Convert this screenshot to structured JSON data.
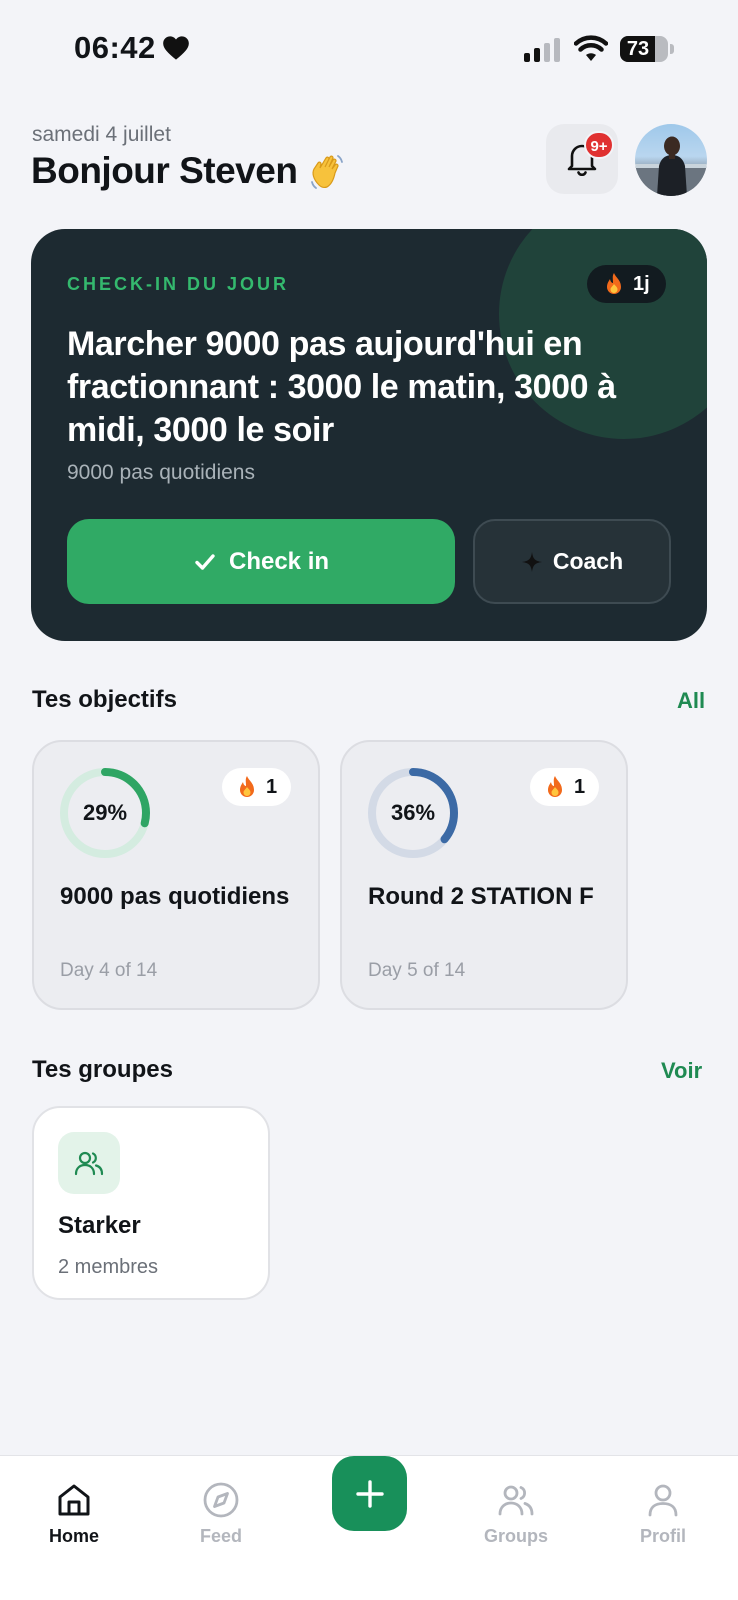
{
  "status_bar": {
    "time": "06:42",
    "battery": "73"
  },
  "header": {
    "date": "samedi 4 juillet",
    "greeting": "Bonjour Steven",
    "notif_badge": "9+"
  },
  "checkin": {
    "label": "CHECK-IN DU JOUR",
    "streak": "1j",
    "title": "Marcher 9000 pas aujourd'hui en fractionnant : 3000 le matin, 3000 à midi, 3000 le soir",
    "subtitle": "9000 pas quotidiens",
    "checkin_label": "Check in",
    "coach_label": "Coach"
  },
  "objectives": {
    "title": "Tes objectifs",
    "link": "All",
    "items": [
      {
        "progress": 0.29,
        "percent": "29%",
        "streak": "1",
        "title": "9000 pas quotidiens",
        "day": "Day 4 of 14",
        "color": "#2fa564",
        "track": "#d4ece0"
      },
      {
        "progress": 0.36,
        "percent": "36%",
        "streak": "1",
        "title": "Round 2 STATION F",
        "day": "Day 5 of 14",
        "color": "#3c6aa5",
        "track": "#d3dae6"
      }
    ]
  },
  "groups": {
    "title": "Tes groupes",
    "link": "Voir",
    "items": [
      {
        "name": "Starker",
        "members": "2 membres"
      }
    ]
  },
  "tabbar": {
    "home": "Home",
    "feed": "Feed",
    "groups": "Groups",
    "profile": "Profil"
  },
  "colors": {
    "accent": "#30aa65",
    "card_dark": "#1d2a31",
    "link": "#1f8a52"
  }
}
